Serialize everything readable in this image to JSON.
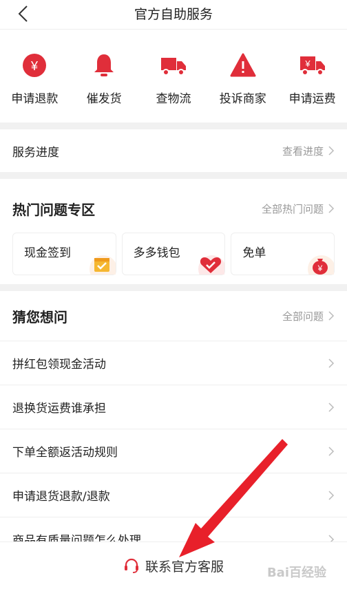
{
  "header": {
    "title": "官方自助服务"
  },
  "shortcuts": [
    {
      "label": "申请退款",
      "icon": "yuan-circle-icon"
    },
    {
      "label": "催发货",
      "icon": "bell-icon"
    },
    {
      "label": "查物流",
      "icon": "truck-icon"
    },
    {
      "label": "投诉商家",
      "icon": "warning-icon"
    },
    {
      "label": "申请运费",
      "icon": "yuan-truck-icon"
    }
  ],
  "progress": {
    "label": "服务进度",
    "link": "查看进度"
  },
  "hot": {
    "title": "热门问题专区",
    "link": "全部热门问题",
    "cards": [
      {
        "label": "现金签到",
        "icon": "calendar-check-icon"
      },
      {
        "label": "多多钱包",
        "icon": "heart-wallet-icon"
      },
      {
        "label": "免单",
        "icon": "money-bag-icon"
      }
    ]
  },
  "guess": {
    "title": "猜您想问",
    "link": "全部问题",
    "items": [
      "拼红包领现金活动",
      "退换货运费谁承担",
      "下单全额返活动规则",
      "申请退货退款/退款",
      "商品有质量问题怎么处理"
    ]
  },
  "footer": {
    "label": "联系官方客服"
  },
  "watermark": "Bai百经验",
  "colors": {
    "accent": "#e02e3a",
    "muted": "#999999"
  }
}
